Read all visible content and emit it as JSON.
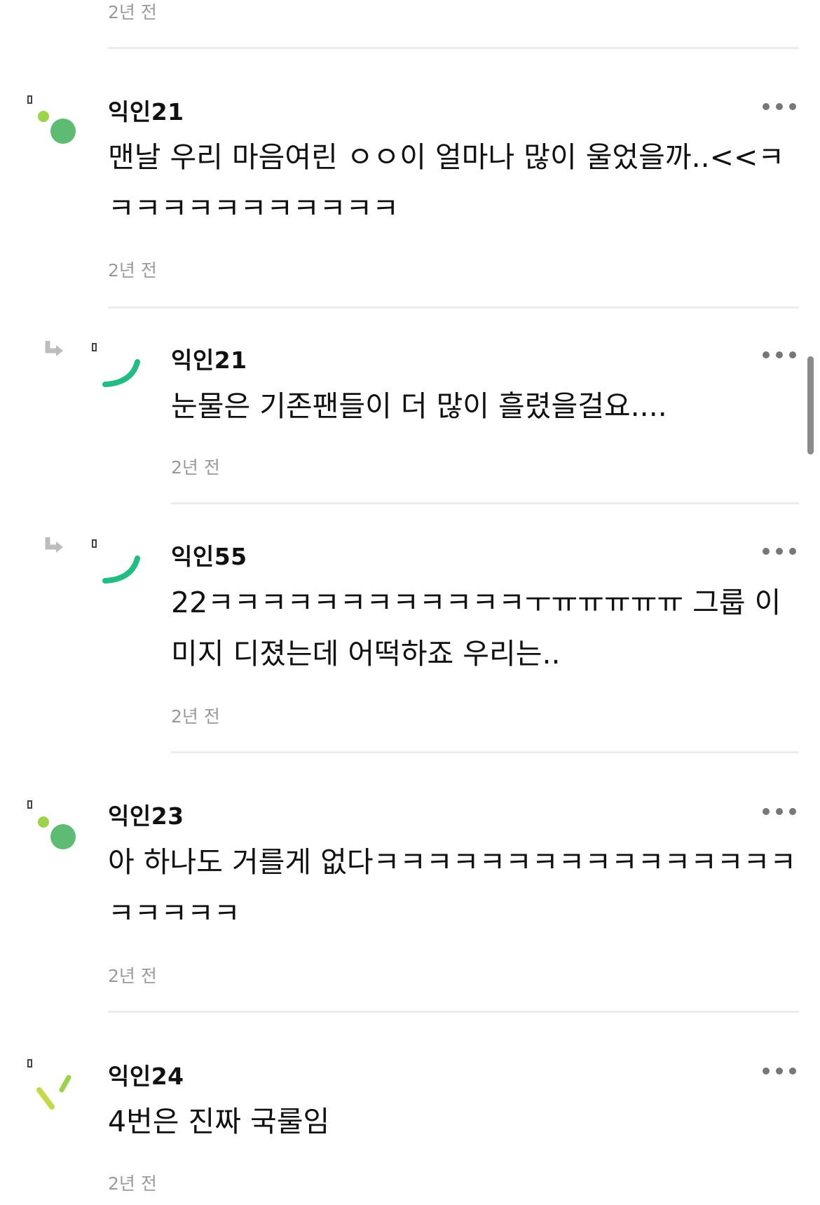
{
  "top_partial": {
    "time": "2년 전"
  },
  "more_icon": "more-horizontal-icon",
  "colors": {
    "accent_green": "#5dbb73",
    "lime": "#9bd44a",
    "teal": "#22bd84",
    "yellow_green": "#c5d84a"
  },
  "comments": [
    {
      "author": "익인21",
      "text": "맨날 우리 마음여린 ㅇㅇ이 얼마나 많이 울었을까..<<ㅋㅋㅋㅋㅋㅋㅋㅋㅋㅋㅋㅋ",
      "time": "2년 전",
      "is_reply": false
    },
    {
      "author": "익인21",
      "text": "눈물은 기존팬들이 더 많이 흘렸을걸요....",
      "time": "2년 전",
      "is_reply": true
    },
    {
      "author": "익인55",
      "text": "22ㅋㅋㅋㅋㅋㅋㅋㅋㅋㅋㅋㅋㅜㅠㅠㅠㅠㅠ 그룹 이미지 디졌는데 어떡하죠 우리는..",
      "time": "2년 전",
      "is_reply": true
    },
    {
      "author": "익인23",
      "text": "아 하나도 거를게 없다ㅋㅋㅋㅋㅋㅋㅋㅋㅋㅋㅋㅋㅋㅋㅋㅋㅋㅋㅋㅋㅋ",
      "time": "2년 전",
      "is_reply": false
    },
    {
      "author": "익인24",
      "text": "4번은 진짜 국룰임",
      "time": "2년 전",
      "is_reply": false
    }
  ]
}
